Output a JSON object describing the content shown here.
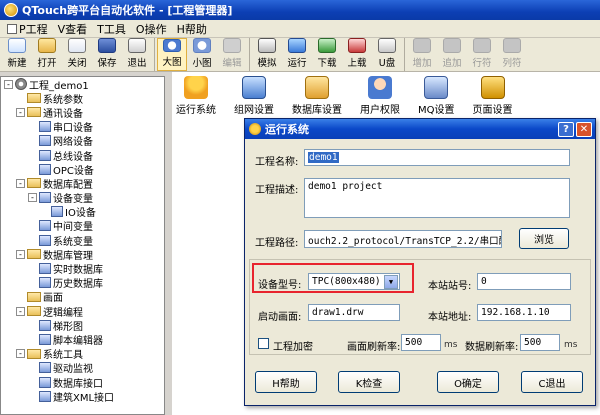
{
  "app": {
    "title": "QTouch跨平台自动化软件 - [工程管理器]"
  },
  "menu": [
    {
      "label": "P工程"
    },
    {
      "label": "V查看"
    },
    {
      "label": "T工具"
    },
    {
      "label": "O操作"
    },
    {
      "label": "H帮助"
    }
  ],
  "toolbar": {
    "new": "新建",
    "open": "打开",
    "close": "关闭",
    "save": "保存",
    "exit": "退出",
    "large": "大图",
    "small": "小图",
    "edit": "编辑",
    "simulate": "模拟",
    "run": "运行",
    "download": "下载",
    "upload": "上载",
    "udisk": "U盘",
    "add": "增加",
    "append": "追加",
    "rowop": "行符",
    "colop": "列符"
  },
  "tree": {
    "items": [
      {
        "label": "工程_demo1",
        "level": 0,
        "exp": "-"
      },
      {
        "label": "系统参数",
        "level": 1,
        "exp": ""
      },
      {
        "label": "通讯设备",
        "level": 1,
        "exp": "-"
      },
      {
        "label": "串口设备",
        "level": 2,
        "exp": ""
      },
      {
        "label": "网络设备",
        "level": 2,
        "exp": ""
      },
      {
        "label": "总线设备",
        "level": 2,
        "exp": ""
      },
      {
        "label": "OPC设备",
        "level": 2,
        "exp": ""
      },
      {
        "label": "数据库配置",
        "level": 1,
        "exp": "-"
      },
      {
        "label": "设备变量",
        "level": 2,
        "exp": "-"
      },
      {
        "label": "IO设备",
        "level": 3,
        "exp": ""
      },
      {
        "label": "中间变量",
        "level": 2,
        "exp": ""
      },
      {
        "label": "系统变量",
        "level": 2,
        "exp": ""
      },
      {
        "label": "数据库管理",
        "level": 1,
        "exp": "-"
      },
      {
        "label": "实时数据库",
        "level": 2,
        "exp": ""
      },
      {
        "label": "历史数据库",
        "level": 2,
        "exp": ""
      },
      {
        "label": "画面",
        "level": 1,
        "exp": ""
      },
      {
        "label": "逻辑编程",
        "level": 1,
        "exp": "-"
      },
      {
        "label": "梯形图",
        "level": 2,
        "exp": ""
      },
      {
        "label": "脚本编辑器",
        "level": 2,
        "exp": ""
      },
      {
        "label": "系统工具",
        "level": 1,
        "exp": "-"
      },
      {
        "label": "驱动监视",
        "level": 2,
        "exp": ""
      },
      {
        "label": "数据库接口",
        "level": 2,
        "exp": ""
      },
      {
        "label": "建筑XML接口",
        "level": 2,
        "exp": ""
      }
    ]
  },
  "icons": [
    {
      "label": "运行系统"
    },
    {
      "label": "组网设置"
    },
    {
      "label": "数据库设置"
    },
    {
      "label": "用户权限"
    },
    {
      "label": "MQ设置"
    },
    {
      "label": "页面设置"
    }
  ],
  "dialog": {
    "title": "运行系统",
    "project_name_label": "工程名称:",
    "project_name_value": "demo1",
    "project_desc_label": "工程描述:",
    "project_desc_value": "demo1 project",
    "project_path_label": "工程路径:",
    "project_path_value": "ouch2.2_protocol/TransTCP_2.2/串口配置透传",
    "browse_label": "浏览",
    "device_model_label": "设备型号:",
    "device_model_value": "TPC(800x480)",
    "station_no_label": "本站站号:",
    "station_no_value": "0",
    "start_screen_label": "启动画面:",
    "start_screen_value": "draw1.drw",
    "station_addr_label": "本站地址:",
    "station_addr_value": "192.168.1.10",
    "encrypt_label": "工程加密",
    "screen_refresh_label": "画面刷新率:",
    "screen_refresh_value": "500",
    "screen_refresh_unit": "ms",
    "data_refresh_label": "数据刷新率:",
    "data_refresh_value": "500",
    "data_refresh_unit": "ms",
    "help_btn": "H帮助",
    "check_btn": "K检查",
    "ok_btn": "O确定",
    "cancel_btn": "C退出"
  }
}
